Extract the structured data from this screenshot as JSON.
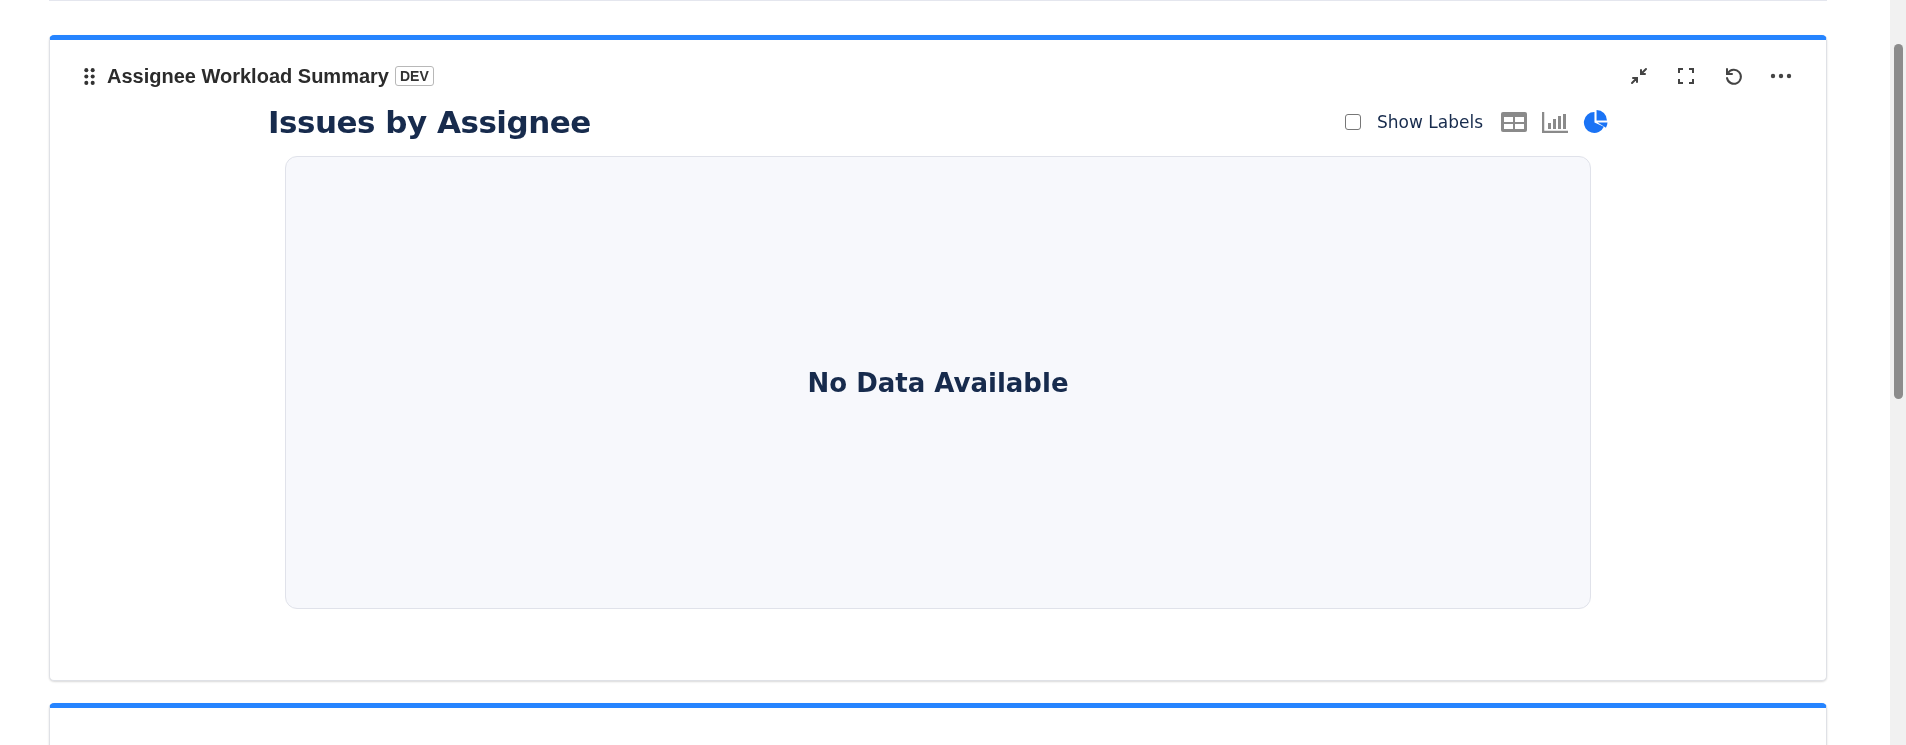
{
  "card": {
    "title": "Assignee Workload Summary",
    "badge": "DEV",
    "actions": [
      {
        "kind": "collapse"
      },
      {
        "kind": "fullscreen"
      },
      {
        "kind": "refresh"
      },
      {
        "kind": "more"
      }
    ]
  },
  "chart": {
    "title": "Issues by Assignee",
    "show_labels": {
      "label": "Show Labels",
      "checked": false
    },
    "views": [
      {
        "kind": "table",
        "selected": false
      },
      {
        "kind": "bar",
        "selected": false
      },
      {
        "kind": "pie",
        "selected": true
      }
    ],
    "empty_message": "No Data Available"
  }
}
